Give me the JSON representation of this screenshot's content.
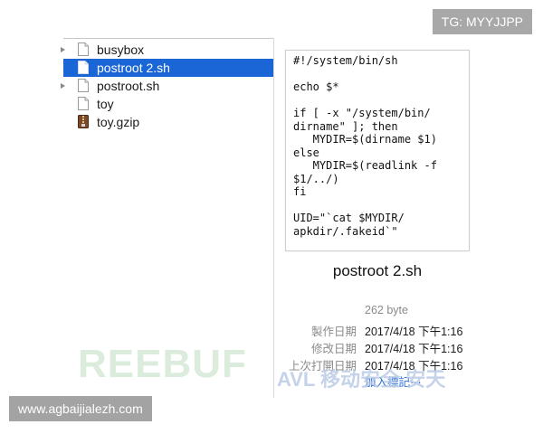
{
  "overlay": {
    "tg_badge": "TG: MYYJJPP",
    "website": "www.agbaijialezh.com",
    "watermark_left": "REEBUF",
    "watermark_right": "AVL 移动安全 安天"
  },
  "file_list": [
    {
      "name": "busybox",
      "expandable": true,
      "icon": "document-icon",
      "selected": false
    },
    {
      "name": "postroot 2.sh",
      "expandable": false,
      "icon": "document-icon",
      "selected": true
    },
    {
      "name": "postroot.sh",
      "expandable": true,
      "icon": "document-icon",
      "selected": false
    },
    {
      "name": "toy",
      "expandable": false,
      "icon": "document-icon",
      "selected": false
    },
    {
      "name": "toy.gzip",
      "expandable": false,
      "icon": "archive-icon",
      "selected": false
    }
  ],
  "preview": {
    "code": "#!/system/bin/sh\n\necho $*\n\nif [ -x \"/system/bin/\ndirname\" ]; then\n   MYDIR=$(dirname $1)\nelse\n   MYDIR=$(readlink -f\n$1/../)\nfi\n\nUID=\"`cat $MYDIR/\napkdir/.fakeid`\"",
    "title": "postroot 2.sh"
  },
  "info": {
    "size": "262 byte",
    "rows": [
      {
        "key": "製作日期",
        "value": "2017/4/18 下午1:16"
      },
      {
        "key": "修改日期",
        "value": "2017/4/18 下午1:16"
      },
      {
        "key": "上次打開日期",
        "value": "2017/4/18 下午1:16"
      }
    ],
    "add_tag": "加入標記⋯"
  },
  "colors": {
    "selection": "#1a66d6",
    "link": "#2a6fd6"
  }
}
